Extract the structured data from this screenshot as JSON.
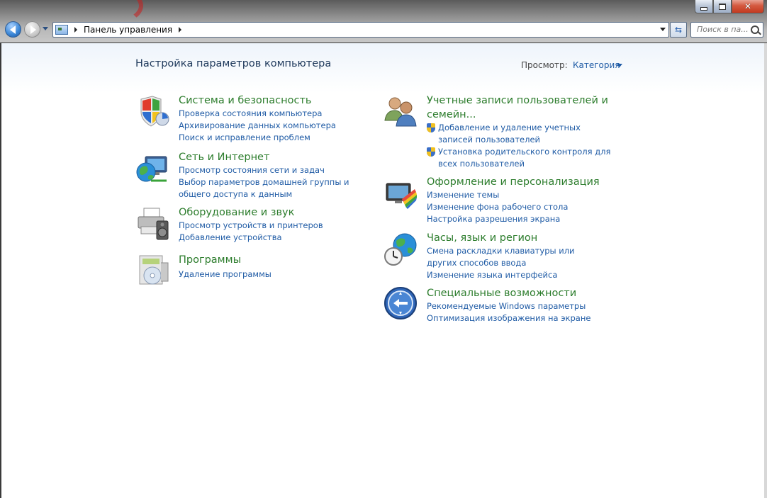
{
  "titlebar": {
    "minimize_label": "–",
    "maximize_label": "□",
    "close_label": "✕"
  },
  "nav": {
    "back_icon": "back-arrow-icon",
    "forward_icon": "forward-arrow-icon"
  },
  "address": {
    "crumbs": [
      "Панель управления"
    ]
  },
  "search": {
    "placeholder": "Поиск в па..."
  },
  "page": {
    "title": "Настройка параметров компьютера",
    "view_label": "Просмотр:",
    "view_value": "Категория"
  },
  "categories_left": [
    {
      "icon": "security-shield-icon",
      "title": "Система и безопасность",
      "links": [
        "Проверка состояния компьютера",
        "Архивирование данных компьютера",
        "Поиск и исправление проблем"
      ]
    },
    {
      "icon": "network-globe-icon",
      "title": "Сеть и Интернет",
      "links": [
        "Просмотр состояния сети и задач",
        "Выбор параметров домашней группы и общего доступа к данным"
      ]
    },
    {
      "icon": "printer-speaker-icon",
      "title": "Оборудование и звук",
      "links": [
        "Просмотр устройств и принтеров",
        "Добавление устройства"
      ]
    },
    {
      "icon": "programs-disc-icon",
      "title": "Программы",
      "links": [
        "Удаление программы"
      ]
    }
  ],
  "categories_right": [
    {
      "icon": "user-accounts-icon",
      "title": "Учетные записи пользователей и семейн...",
      "links": [
        "Добавление и удаление учетных записей пользователей",
        "Установка родительского контроля для всех пользователей"
      ]
    },
    {
      "icon": "appearance-palette-icon",
      "title": "Оформление и персонализация",
      "links": [
        "Изменение темы",
        "Изменение фона рабочего стола",
        "Настройка разрешения экрана"
      ]
    },
    {
      "icon": "clock-globe-icon",
      "title": "Часы, язык и регион",
      "links": [
        "Смена раскладки клавиатуры или других способов ввода",
        "Изменение языка интерфейса"
      ]
    },
    {
      "icon": "accessibility-icon",
      "title": "Специальные возможности",
      "links": [
        "Рекомендуемые Windows параметры",
        "Оптимизация изображения на экране"
      ]
    }
  ],
  "colors": {
    "category_title": "#2d7d2d",
    "link": "#1f5ba5",
    "page_title": "#1e395b"
  }
}
